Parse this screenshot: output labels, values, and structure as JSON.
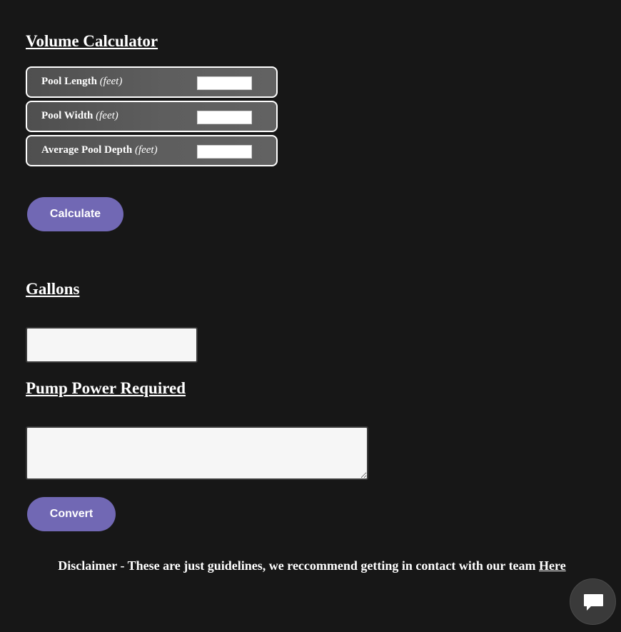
{
  "volume_calculator": {
    "title": "Volume Calculator",
    "fields": [
      {
        "label": "Pool Length",
        "unit": "(feet)",
        "value": ""
      },
      {
        "label": "Pool Width",
        "unit": "(feet)",
        "value": ""
      },
      {
        "label": "Average Pool Depth",
        "unit": "(feet)",
        "value": ""
      }
    ],
    "calculate_label": "Calculate"
  },
  "gallons": {
    "title": "Gallons",
    "value": ""
  },
  "pump_power": {
    "title": "Pump Power Required",
    "value": "",
    "convert_label": "Convert"
  },
  "disclaimer": {
    "text": "Disclaimer - These are just guidelines, we reccommend getting in contact with our team ",
    "link_label": "Here"
  },
  "chat": {
    "icon": "chat-bubble-icon"
  }
}
